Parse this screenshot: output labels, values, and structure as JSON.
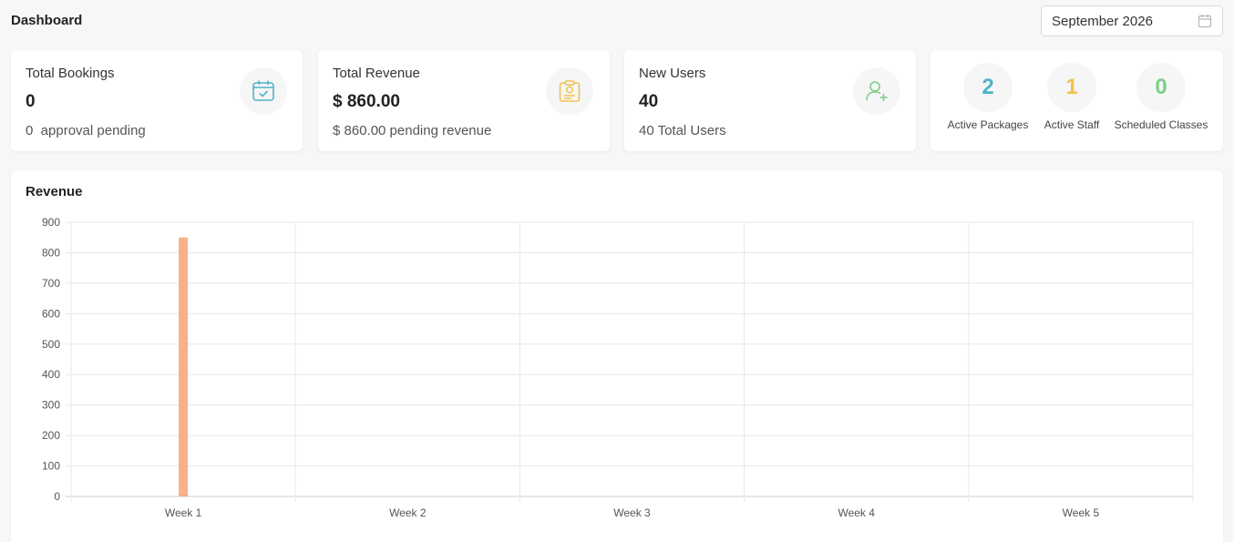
{
  "header": {
    "title": "Dashboard",
    "date_picker": {
      "value": "September 2026",
      "icon": "calendar-icon"
    }
  },
  "cards": {
    "bookings": {
      "title": "Total Bookings",
      "value": "0",
      "sub": "0  approval pending",
      "icon": "calendar-check-icon",
      "color": "#4fb3c9"
    },
    "revenue": {
      "title": "Total Revenue",
      "value": "$ 860.00",
      "sub": "$ 860.00 pending revenue",
      "icon": "revenue-badge-icon",
      "color": "#f2c14e"
    },
    "users": {
      "title": "New Users",
      "value": "40",
      "sub": "40 Total Users",
      "icon": "user-add-icon",
      "color": "#7ccf87"
    }
  },
  "stats": [
    {
      "value": "2",
      "label": "Active Packages",
      "color": "#4fb3c9"
    },
    {
      "value": "1",
      "label": "Active Staff",
      "color": "#f2c14e"
    },
    {
      "value": "0",
      "label": "Scheduled Classes",
      "color": "#7ccf87"
    }
  ],
  "chart_title": "Revenue",
  "chart_data": {
    "type": "bar",
    "categories": [
      "Week 1",
      "Week 2",
      "Week 3",
      "Week 4",
      "Week 5"
    ],
    "values": [
      850,
      0,
      0,
      0,
      0
    ],
    "ylim": [
      0,
      900
    ],
    "yticks": [
      0,
      100,
      200,
      300,
      400,
      500,
      600,
      700,
      800,
      900
    ],
    "grid": true,
    "bar_color": "#f7b088"
  }
}
